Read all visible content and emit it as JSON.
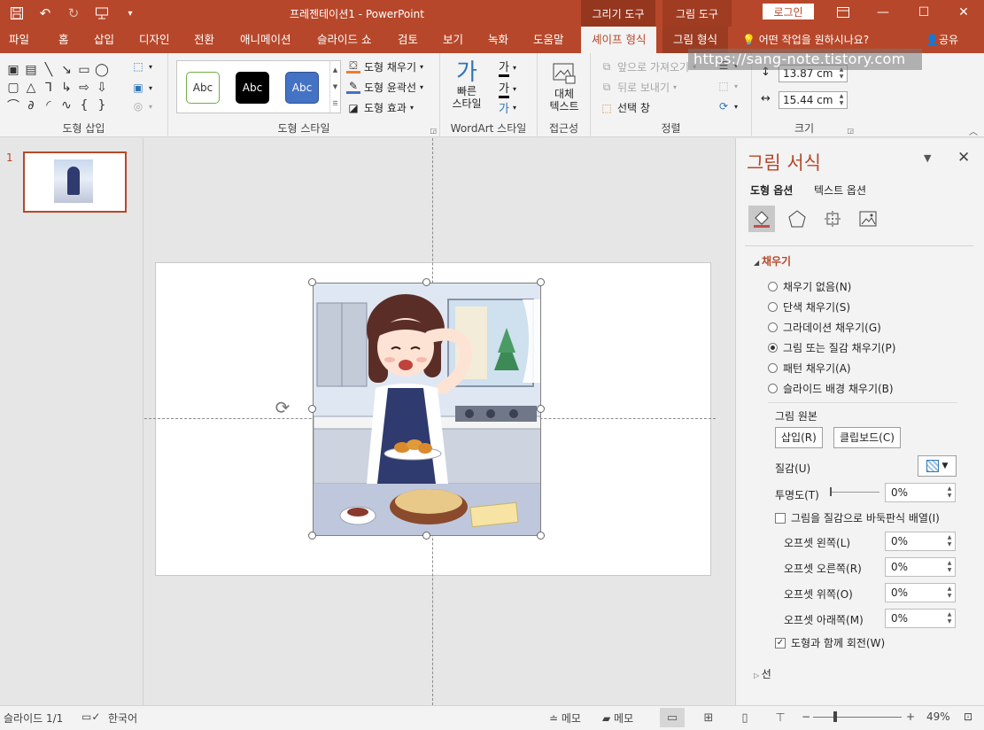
{
  "titlebar": {
    "doc_title": "프레젠테이션1  -  PowerPoint",
    "ctx_drawing_tools": "그리기 도구",
    "ctx_picture_tools": "그림 도구",
    "login": "로그인"
  },
  "tabs": [
    {
      "label": "파일"
    },
    {
      "label": "홈"
    },
    {
      "label": "삽입"
    },
    {
      "label": "디자인"
    },
    {
      "label": "전환"
    },
    {
      "label": "애니메이션"
    },
    {
      "label": "슬라이드 쇼"
    },
    {
      "label": "검토"
    },
    {
      "label": "보기"
    },
    {
      "label": "녹화"
    },
    {
      "label": "도움말"
    },
    {
      "label": "셰이프 형식"
    },
    {
      "label": "그림 형식"
    }
  ],
  "tell_me": "어떤 작업을 원하시나요?",
  "share": "공유",
  "ribbon": {
    "insert_shapes_label": "도형 삽입",
    "shape_styles_label": "도형 스타일",
    "abc": "Abc",
    "shape_fill": "도형 채우기",
    "shape_outline": "도형 윤곽선",
    "shape_effects": "도형 효과",
    "quick_styles": "빠른\n스타일",
    "wordart_label": "WordArt 스타일",
    "ga": "가",
    "alt_text": "대체\n텍스트",
    "accessibility_label": "접근성",
    "bring_forward": "앞으로 가져오기",
    "send_backward": "뒤로 보내기",
    "selection_pane": "선택 창",
    "arrange_label": "정렬",
    "height": "13.87 cm",
    "width": "15.44 cm",
    "size_label": "크기"
  },
  "watermark": "https://sang-note.tistory.com",
  "slides_pane": {
    "slide_number": "1"
  },
  "format_pane": {
    "title": "그림 서식",
    "tab_shape_options": "도형 옵션",
    "tab_text_options": "텍스트 옵션",
    "fill_header": "채우기",
    "fill_options": [
      {
        "label": "채우기 없음(N)",
        "selected": false
      },
      {
        "label": "단색 채우기(S)",
        "selected": false
      },
      {
        "label": "그라데이션 채우기(G)",
        "selected": false
      },
      {
        "label": "그림 또는 질감 채우기(P)",
        "selected": true
      },
      {
        "label": "패턴 채우기(A)",
        "selected": false
      },
      {
        "label": "슬라이드 배경 채우기(B)",
        "selected": false
      }
    ],
    "picture_source": "그림 원본",
    "insert_btn": "삽입(R)",
    "clipboard_btn": "클립보드(C)",
    "texture": "질감(U)",
    "transparency": "투명도(T)",
    "transparency_value": "0%",
    "tile_label": "그림을 질감으로 바둑판식 배열(I)",
    "offset_left": "오프셋 왼쪽(L)",
    "offset_right": "오프셋 오른쪽(R)",
    "offset_top": "오프셋 위쪽(O)",
    "offset_bottom": "오프셋 아래쪽(M)",
    "offset_left_value": "0%",
    "offset_right_value": "0%",
    "offset_top_value": "0%",
    "offset_bottom_value": "0%",
    "rotate_with_shape": "도형과 함께 회전(W)",
    "line_header": "선"
  },
  "statusbar": {
    "slide_info": "슬라이드 1/1",
    "language": "한국어",
    "notes": "메모",
    "comments": "메모",
    "zoom": "49%"
  },
  "colors": {
    "accent": "#b7472a",
    "pane_bg": "#f3f3f3"
  }
}
